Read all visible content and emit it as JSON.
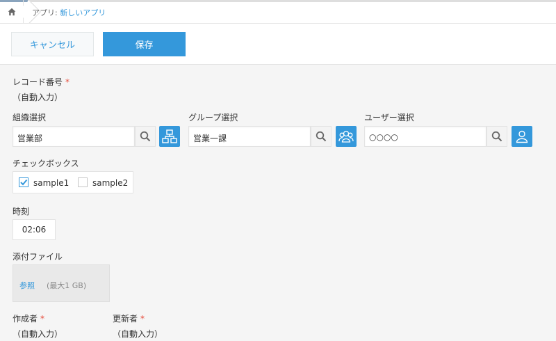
{
  "breadcrumb": {
    "prefix": "アプリ: ",
    "app_name": "新しいアプリ"
  },
  "toolbar": {
    "cancel_label": "キャンセル",
    "save_label": "保存"
  },
  "fields": {
    "record_number": {
      "label": "レコード番号",
      "required_mark": "*",
      "value": "（自動入力）"
    },
    "org_select": {
      "label": "組織選択",
      "value": "営業部"
    },
    "group_select": {
      "label": "グループ選択",
      "value": "営業一課"
    },
    "user_select": {
      "label": "ユーザー選択",
      "value": "○○○○"
    },
    "checkbox": {
      "label": "チェックボックス",
      "options": [
        {
          "label": "sample1",
          "checked": true
        },
        {
          "label": "sample2",
          "checked": false
        }
      ]
    },
    "time": {
      "label": "時刻",
      "value": "02:06"
    },
    "attachment": {
      "label": "添付ファイル",
      "browse_label": "参照",
      "limit_text": "(最大1 GB)"
    },
    "creator": {
      "label": "作成者",
      "required_mark": "*",
      "value": "（自動入力）"
    },
    "updater": {
      "label": "更新者",
      "required_mark": "*",
      "value": "（自動入力）"
    }
  },
  "colors": {
    "accent": "#3498db",
    "required": "#e74c3c"
  },
  "icons": {
    "home": "home-icon",
    "search": "search-icon",
    "org": "org-chart-icon",
    "group": "group-icon",
    "user": "user-icon",
    "check": "check-icon"
  }
}
